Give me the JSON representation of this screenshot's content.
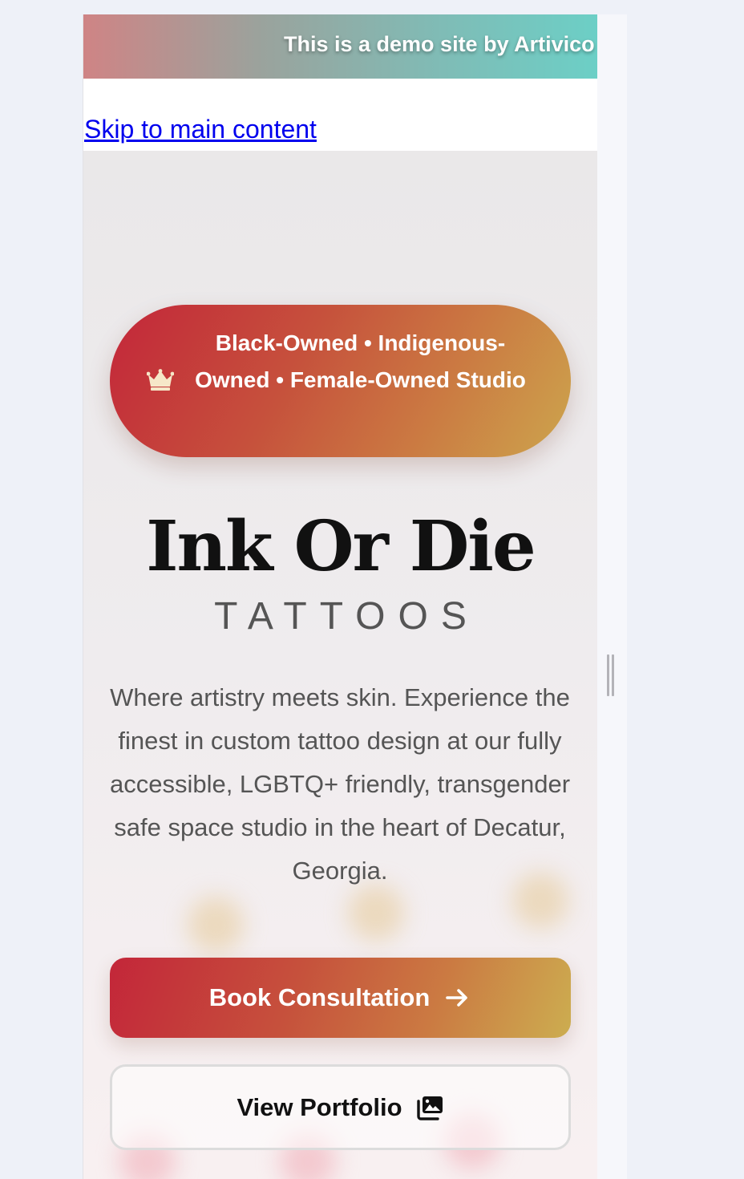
{
  "demo_banner": {
    "text": "This is a demo site by Artivico"
  },
  "skip_link": {
    "label": "Skip to main content"
  },
  "hero": {
    "badge": {
      "icon": "crown-icon",
      "text": "Black-Owned • Indigenous-Owned • Female-Owned Studio"
    },
    "logo": {
      "title": "Ink Or Die",
      "subtitle": "TATTOOS"
    },
    "tagline": "Where artistry meets skin. Experience the finest in custom tattoo design at our fully accessible, LGBTQ+ friendly, transgender safe space studio in the heart of Decatur, Georgia.",
    "buttons": {
      "book_label": "Book Consultation",
      "book_icon": "arrow-right-icon",
      "portfolio_label": "View Portfolio",
      "portfolio_icon": "images-icon"
    }
  },
  "colors": {
    "accent_start": "#c32639",
    "accent_end": "#cca54d",
    "banner_start": "#cf8485",
    "banner_end": "#6ccfc6",
    "link": "#0000ee"
  }
}
